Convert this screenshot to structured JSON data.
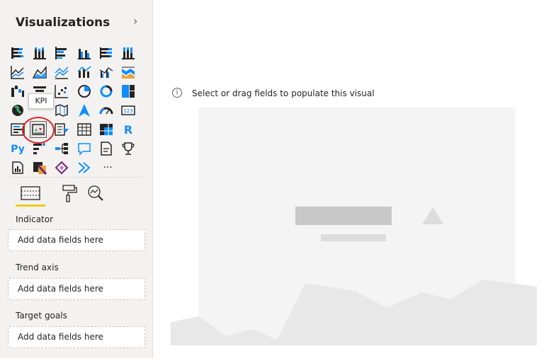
{
  "pane": {
    "title": "Visualizations",
    "collapse_icon": "chevron-right-icon",
    "tooltip": "KPI",
    "viz_rows": [
      [
        "stacked-bar-chart-icon",
        "stacked-column-chart-icon",
        "clustered-bar-chart-icon",
        "clustered-column-chart-icon",
        "100-stacked-bar-chart-icon",
        "100-stacked-column-chart-icon"
      ],
      [
        "line-chart-icon",
        "area-chart-icon",
        "stacked-area-chart-icon",
        "line-and-stacked-column-chart-icon",
        "line-and-clustered-column-chart-icon",
        "ribbon-chart-icon"
      ],
      [
        "waterfall-chart-icon",
        "funnel-chart-icon",
        "scatter-chart-icon",
        "pie-chart-icon",
        "donut-chart-icon",
        "treemap-icon"
      ],
      [
        "map-icon",
        "filled-map-icon",
        "shape-map-icon",
        "azure-map-icon",
        "gauge-icon",
        "card-icon"
      ],
      [
        "multi-row-card-icon",
        "kpi-icon",
        "slicer-icon",
        "table-icon",
        "matrix-icon",
        "r-script-visual-icon"
      ],
      [
        "python-visual-icon",
        "key-influencers-icon",
        "decomposition-tree-icon",
        "qa-icon",
        "smart-narrative-icon",
        "goals-icon"
      ],
      [
        "paginated-report-icon",
        "power-apps-icon",
        "power-automate-icon",
        "arcgis-icon",
        "more-visuals-icon"
      ]
    ],
    "r_label": "R",
    "py_label": "Py",
    "more_label": "···",
    "panel_tabs": [
      "fields-icon",
      "format-paintbrush-icon",
      "analytics-magnifier-icon"
    ],
    "wells": [
      {
        "label": "Indicator",
        "placeholder": "Add data fields here"
      },
      {
        "label": "Trend axis",
        "placeholder": "Add data fields here"
      },
      {
        "label": "Target goals",
        "placeholder": "Add data fields here"
      }
    ]
  },
  "canvas": {
    "hint": "Select or drag fields to populate this visual",
    "info_icon": "info-icon",
    "info_glyph": "i"
  },
  "colors": {
    "accent_underline": "#f2c811",
    "highlight_circle": "#e02020",
    "icon_blue": "#118dff",
    "icon_dark": "#252423"
  }
}
